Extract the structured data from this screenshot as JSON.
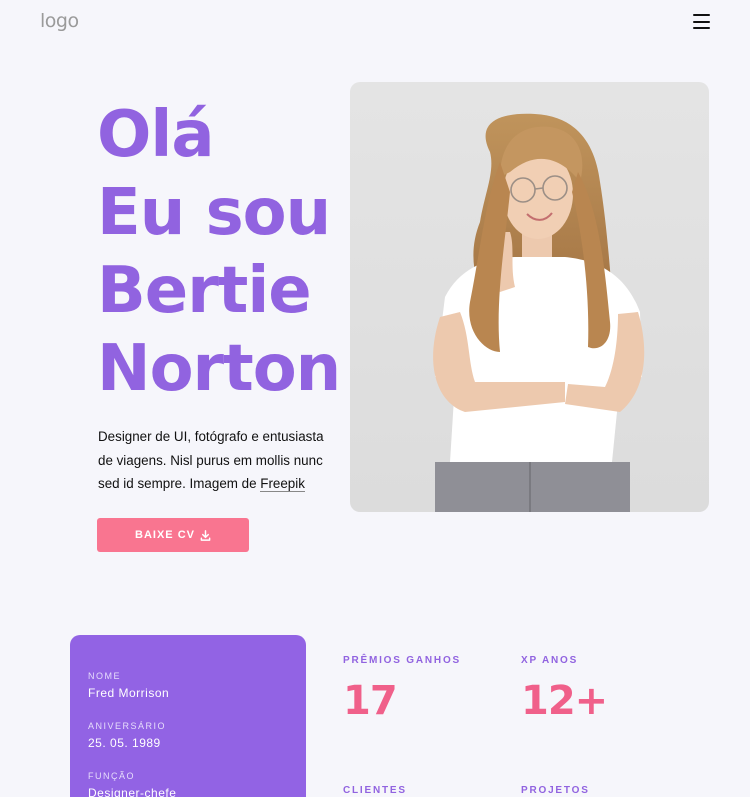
{
  "header": {
    "logo": "logo",
    "menu_icon": "hamburger-menu-icon"
  },
  "hero": {
    "title_lines": [
      "Olá",
      "Eu sou",
      "Bertie",
      "Norton"
    ],
    "description_text": "Designer de UI, fotógrafo e entusiasta de viagens. Nisl purus em mollis nunc sed id sempre. Imagem de ",
    "description_link": "Freepik",
    "cv_button": "BAIXE CV",
    "cv_button_icon": "download-icon",
    "photo_alt": "Woman with glasses in white t-shirt"
  },
  "info_card": {
    "items": [
      {
        "label": "NOME",
        "value": "Fred Morrison"
      },
      {
        "label": "ANIVERSÁRIO",
        "value": "25. 05. 1989"
      },
      {
        "label": "FUNÇÃO",
        "value": "Designer-chefe"
      }
    ]
  },
  "stats": [
    {
      "label": "PRÊMIOS GANHOS",
      "value": "17"
    },
    {
      "label": "XP ANOS",
      "value": "12+"
    },
    {
      "label": "CLIENTES",
      "value": ""
    },
    {
      "label": "PROJETOS",
      "value": ""
    }
  ],
  "colors": {
    "accent_purple": "#9163e0",
    "accent_pink": "#f97590",
    "background": "#f6f6fb"
  }
}
